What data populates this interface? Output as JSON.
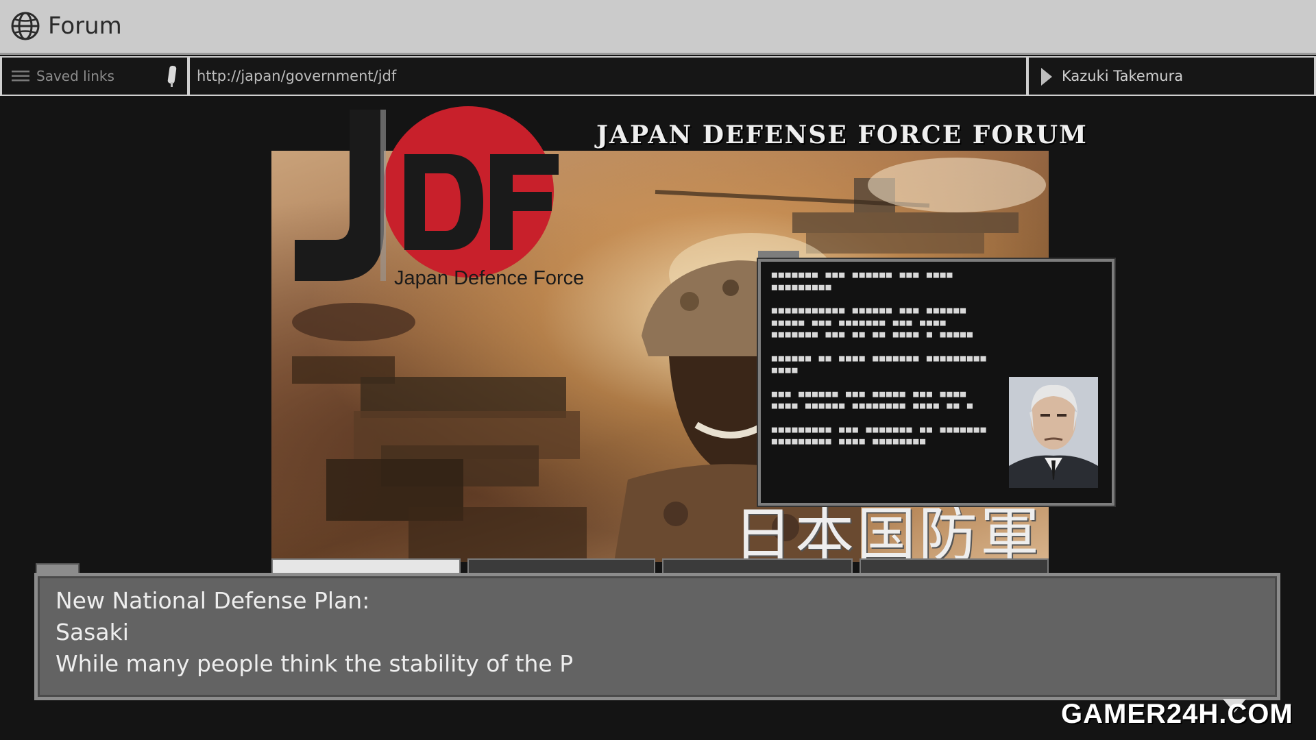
{
  "window": {
    "title": "Forum"
  },
  "navbar": {
    "saved_links_label": "Saved links",
    "url": "http://japan/government/jdf",
    "user_name": "Kazuki Takemura"
  },
  "site": {
    "heading": "JAPAN DEFENSE FORCE FORUM",
    "logo_text": "JDF",
    "logo_subtitle": "Japan Defence Force",
    "kanji_title": "日本国防軍",
    "logo_colors": {
      "red_circle": "#c8202b",
      "letters": "#1a1a1a"
    }
  },
  "popup": {
    "paragraphs": [
      "▀▀▀▀▀▀▀ ▀▀▀ ▀▀▀▀▀▀ ▀▀▀ ▀▀▀▀ ▀▀▀▀▀▀▀▀▀",
      "▀▀▀▀▀▀▀▀▀▀▀ ▀▀▀▀▀▀ ▀▀▀ ▀▀▀▀▀▀ ▀▀▀▀▀ ▀▀▀ ▀▀▀▀▀▀▀ ▀▀▀ ▀▀▀▀ ▀▀▀▀▀▀▀ ▀▀▀ ▀▀ ▀▀ ▀▀▀▀ ▀ ▀▀▀▀▀",
      "▀▀▀▀▀▀ ▀▀ ▀▀▀▀ ▀▀▀▀▀▀▀ ▀▀▀▀▀▀▀▀▀ ▀▀▀▀",
      "▀▀▀ ▀▀▀▀▀▀ ▀▀▀ ▀▀▀▀▀ ▀▀▀ ▀▀▀▀ ▀▀▀▀ ▀▀▀▀▀▀ ▀▀▀▀▀▀▀▀ ▀▀▀▀ ▀▀ ▀",
      "▀▀▀▀▀▀▀▀▀ ▀▀▀ ▀▀▀▀▀▀▀ ▀▀ ▀▀▀▀▀▀▀ ▀▀▀▀▀▀▀▀▀ ▀▀▀▀ ▀▀▀▀▀▀▀▀"
    ]
  },
  "dialog": {
    "line1": "New National Defense Plan:",
    "line2": "Sasaki",
    "line3": "While many people think the stability of the P"
  },
  "watermark": "GAMER24H.COM"
}
